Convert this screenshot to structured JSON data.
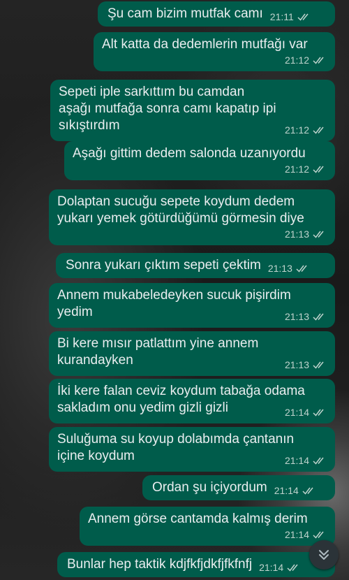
{
  "conversation": {
    "messages": [
      {
        "text": "Şu cam bizim mutfak camı",
        "time": "21:11"
      },
      {
        "text": "Alt katta da dedemlerin mutfağı var",
        "time": "21:12"
      },
      {
        "text": "Sepeti iple sarkıttım bu camdan\naşağı mutfağa sonra camı kapatıp ipi\nsıkıştırdım",
        "time": "21:12"
      },
      {
        "text": "Aşağı gittim dedem salonda uzanıyordu",
        "time": "21:12"
      },
      {
        "text": "Dolaptan sucuğu sepete koydum dedem\nyukarı yemek götürdüğümü görmesin diye",
        "time": "21:13"
      },
      {
        "text": "Sonra yukarı çıktım sepeti çektim",
        "time": "21:13"
      },
      {
        "text": "Annem mukabeledeyken sucuk pişirdim\nyedim",
        "time": "21:13"
      },
      {
        "text": "Bi kere mısır patlattım yine annem\nkurandayken",
        "time": "21:13"
      },
      {
        "text": "İki kere falan ceviz koydum tabağa odama\nsakladım onu yedim gizli gizli",
        "time": "21:14"
      },
      {
        "text": "Suluğuma su koyup dolabımda çantanın\niçine koydum",
        "time": "21:14"
      },
      {
        "text": "Ordan şu içiyordum",
        "time": "21:14"
      },
      {
        "text": "Annem görse cantamda kalmış derim",
        "time": "21:14"
      },
      {
        "text": "Bunlar hep taktik kdjfkfjdkfjfkfnfj",
        "time": "21:14"
      }
    ],
    "read_status_icon": "double-check-icon",
    "scroll_button_icon": "double-chevron-down-icon"
  },
  "colors": {
    "bubble_outgoing": "#005c4b",
    "text": "#e9edef",
    "meta": "#bfd3cd"
  }
}
